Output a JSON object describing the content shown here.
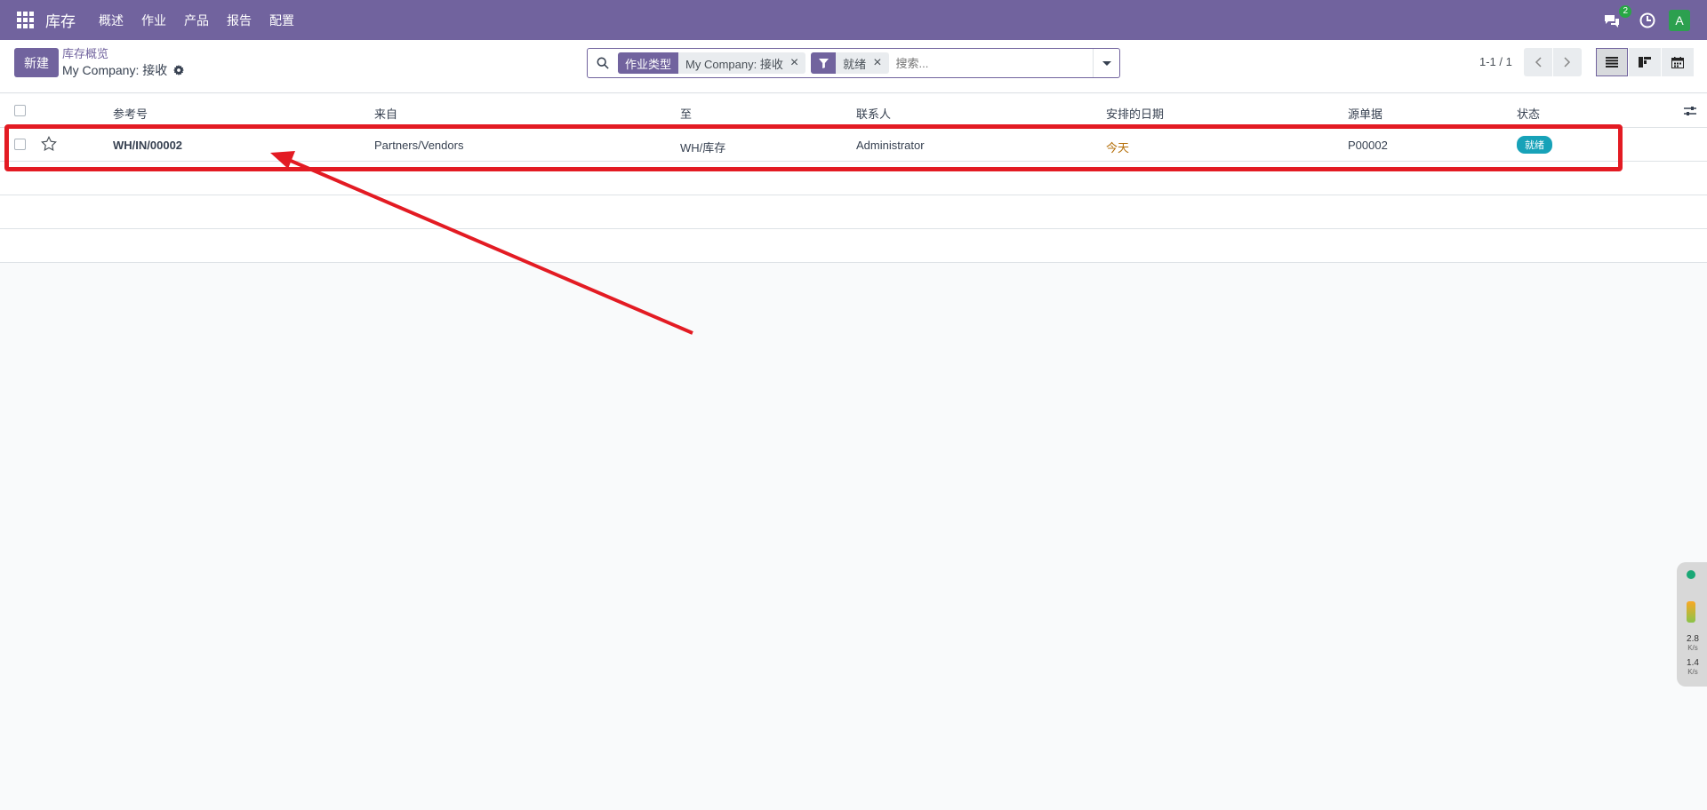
{
  "navbar": {
    "brand": "库存",
    "menu": [
      "概述",
      "作业",
      "产品",
      "报告",
      "配置"
    ],
    "chat_badge": "2",
    "avatar_letter": "A"
  },
  "control_panel": {
    "new_label": "新建",
    "breadcrumb_parent": "库存概览",
    "breadcrumb_current": "My Company: 接收",
    "search": {
      "facets": [
        {
          "label": "作业类型",
          "value": "My Company: 接收"
        },
        {
          "label": "",
          "value": "就绪"
        }
      ],
      "placeholder": "搜索..."
    },
    "pager": "1-1 / 1"
  },
  "table": {
    "columns": [
      "参考号",
      "来自",
      "至",
      "联系人",
      "安排的日期",
      "源单据",
      "状态"
    ],
    "rows": [
      {
        "reference": "WH/IN/00002",
        "from": "Partners/Vendors",
        "to": "WH/库存",
        "contact": "Administrator",
        "scheduled_date": "今天",
        "source_document": "P00002",
        "status": "就绪"
      }
    ]
  },
  "side_widget": {
    "up_speed": "2.8",
    "up_unit": "K/s",
    "down_speed": "1.4",
    "down_unit": "K/s"
  },
  "colors": {
    "brand": "#71639e",
    "status_ready": "#17a2b8",
    "date_today": "#b5700b",
    "highlight": "#e31b23"
  }
}
